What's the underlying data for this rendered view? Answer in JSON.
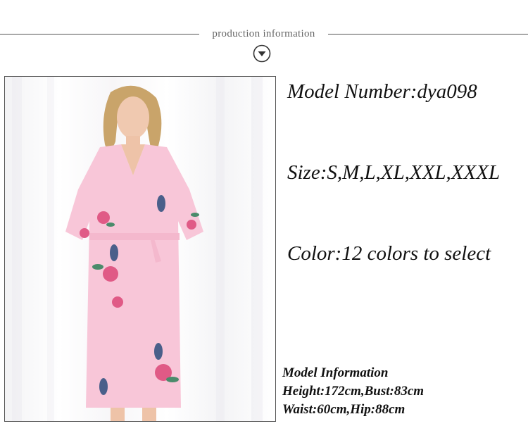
{
  "header": {
    "title": "production information"
  },
  "icons": {
    "down": "chevron-down-circle-icon",
    "photo": "model-photo"
  },
  "colors": {
    "robe_pink": "#f8c6d8",
    "text": "#111111",
    "line": "#555555"
  },
  "product": {
    "model_number": "Model Number:dya098",
    "size": "Size:S,M,L,XL,XXL,XXXL",
    "color": "Color:12 colors to select"
  },
  "model_info": {
    "heading": "Model Information",
    "height_bust": "Height:172cm,Bust:83cm",
    "waist_hip": "Waist:60cm,Hip:88cm"
  }
}
